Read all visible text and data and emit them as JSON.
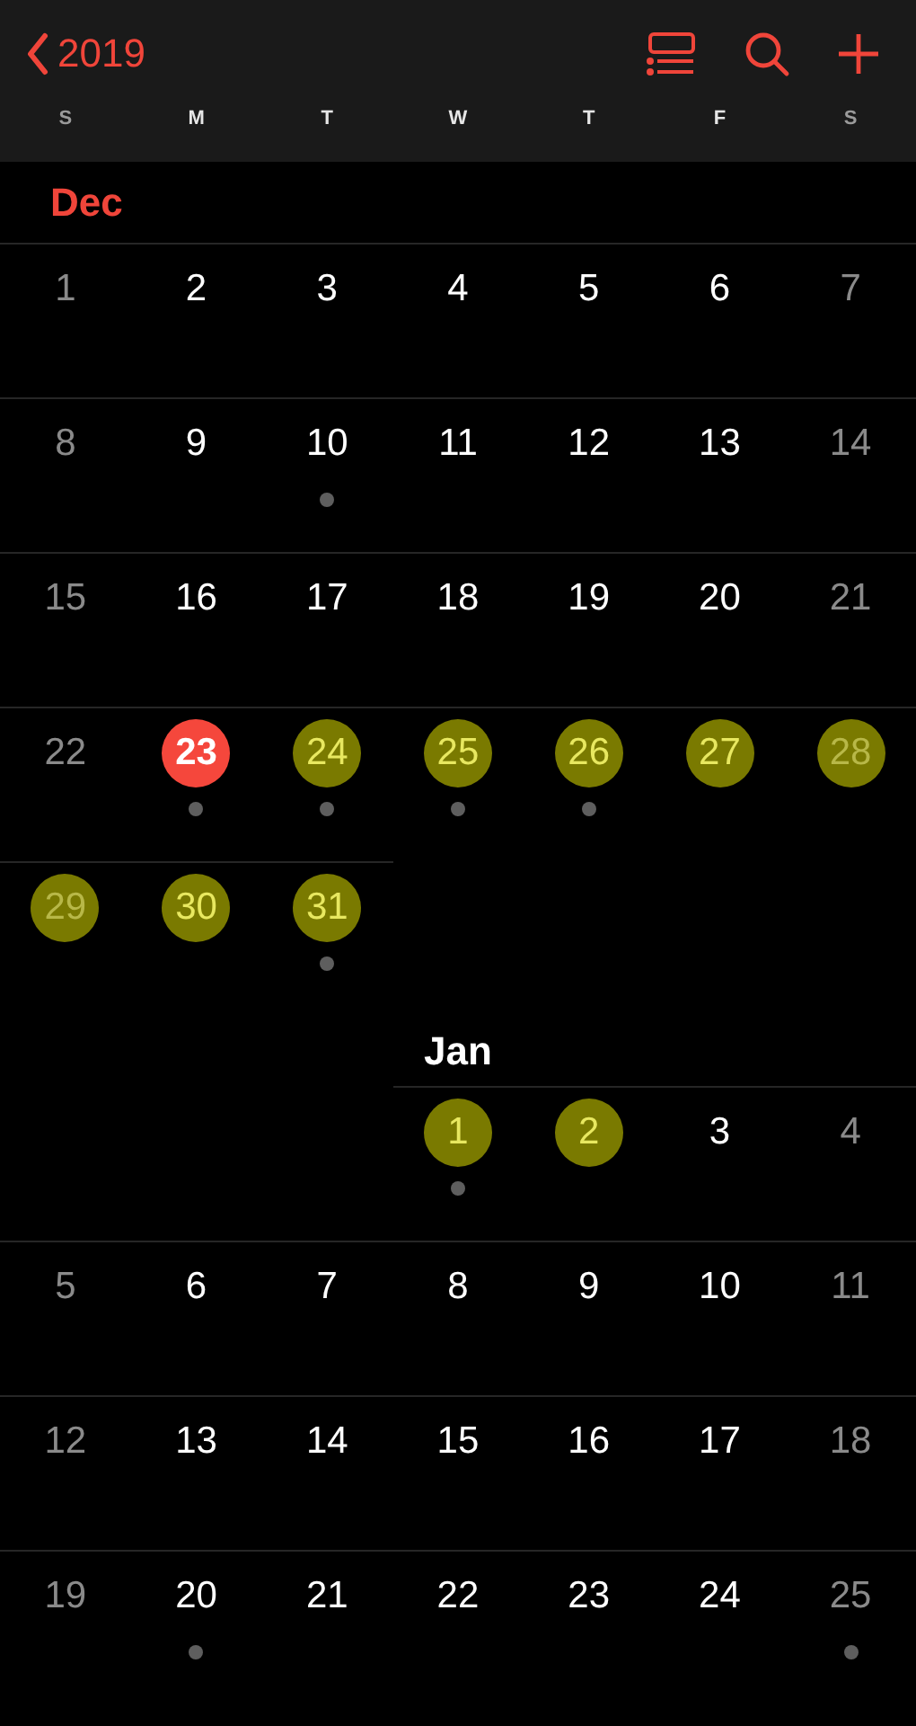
{
  "nav": {
    "back_label": "2019"
  },
  "weekdays": [
    {
      "label": "S",
      "weekend": true
    },
    {
      "label": "M",
      "weekend": false
    },
    {
      "label": "T",
      "weekend": false
    },
    {
      "label": "W",
      "weekend": false
    },
    {
      "label": "T",
      "weekend": false
    },
    {
      "label": "F",
      "weekend": false
    },
    {
      "label": "S",
      "weekend": true
    }
  ],
  "months": [
    {
      "name": "Dec",
      "current": true,
      "weeks": [
        [
          {
            "label": "1",
            "weekend": true,
            "today": false,
            "highlighted": false,
            "event": false
          },
          {
            "label": "2",
            "weekend": false,
            "today": false,
            "highlighted": false,
            "event": false
          },
          {
            "label": "3",
            "weekend": false,
            "today": false,
            "highlighted": false,
            "event": false
          },
          {
            "label": "4",
            "weekend": false,
            "today": false,
            "highlighted": false,
            "event": false
          },
          {
            "label": "5",
            "weekend": false,
            "today": false,
            "highlighted": false,
            "event": false
          },
          {
            "label": "6",
            "weekend": false,
            "today": false,
            "highlighted": false,
            "event": false
          },
          {
            "label": "7",
            "weekend": true,
            "today": false,
            "highlighted": false,
            "event": false
          }
        ],
        [
          {
            "label": "8",
            "weekend": true,
            "today": false,
            "highlighted": false,
            "event": false
          },
          {
            "label": "9",
            "weekend": false,
            "today": false,
            "highlighted": false,
            "event": false
          },
          {
            "label": "10",
            "weekend": false,
            "today": false,
            "highlighted": false,
            "event": true
          },
          {
            "label": "11",
            "weekend": false,
            "today": false,
            "highlighted": false,
            "event": false
          },
          {
            "label": "12",
            "weekend": false,
            "today": false,
            "highlighted": false,
            "event": false
          },
          {
            "label": "13",
            "weekend": false,
            "today": false,
            "highlighted": false,
            "event": false
          },
          {
            "label": "14",
            "weekend": true,
            "today": false,
            "highlighted": false,
            "event": false
          }
        ],
        [
          {
            "label": "15",
            "weekend": true,
            "today": false,
            "highlighted": false,
            "event": false
          },
          {
            "label": "16",
            "weekend": false,
            "today": false,
            "highlighted": false,
            "event": false
          },
          {
            "label": "17",
            "weekend": false,
            "today": false,
            "highlighted": false,
            "event": false
          },
          {
            "label": "18",
            "weekend": false,
            "today": false,
            "highlighted": false,
            "event": false
          },
          {
            "label": "19",
            "weekend": false,
            "today": false,
            "highlighted": false,
            "event": false
          },
          {
            "label": "20",
            "weekend": false,
            "today": false,
            "highlighted": false,
            "event": false
          },
          {
            "label": "21",
            "weekend": true,
            "today": false,
            "highlighted": false,
            "event": false
          }
        ],
        [
          {
            "label": "22",
            "weekend": true,
            "today": false,
            "highlighted": false,
            "event": false
          },
          {
            "label": "23",
            "weekend": false,
            "today": true,
            "highlighted": false,
            "event": true
          },
          {
            "label": "24",
            "weekend": false,
            "today": false,
            "highlighted": true,
            "event": true
          },
          {
            "label": "25",
            "weekend": false,
            "today": false,
            "highlighted": true,
            "event": true
          },
          {
            "label": "26",
            "weekend": false,
            "today": false,
            "highlighted": true,
            "event": true
          },
          {
            "label": "27",
            "weekend": false,
            "today": false,
            "highlighted": true,
            "event": false
          },
          {
            "label": "28",
            "weekend": true,
            "today": false,
            "highlighted": true,
            "event": false
          }
        ],
        [
          {
            "label": "29",
            "weekend": true,
            "today": false,
            "highlighted": true,
            "event": false
          },
          {
            "label": "30",
            "weekend": false,
            "today": false,
            "highlighted": true,
            "event": false
          },
          {
            "label": "31",
            "weekend": false,
            "today": false,
            "highlighted": true,
            "event": true
          },
          {
            "kind": "blank"
          },
          {
            "kind": "blank"
          },
          {
            "kind": "blank"
          },
          {
            "kind": "blank"
          }
        ]
      ]
    },
    {
      "name": "Jan",
      "current": false,
      "weeks": [
        [
          {
            "kind": "blank"
          },
          {
            "kind": "blank"
          },
          {
            "kind": "blank"
          },
          {
            "label": "1",
            "weekend": false,
            "today": false,
            "highlighted": true,
            "event": true
          },
          {
            "label": "2",
            "weekend": false,
            "today": false,
            "highlighted": true,
            "event": false
          },
          {
            "label": "3",
            "weekend": false,
            "today": false,
            "highlighted": false,
            "event": false
          },
          {
            "label": "4",
            "weekend": true,
            "today": false,
            "highlighted": false,
            "event": false
          }
        ],
        [
          {
            "label": "5",
            "weekend": true,
            "today": false,
            "highlighted": false,
            "event": false
          },
          {
            "label": "6",
            "weekend": false,
            "today": false,
            "highlighted": false,
            "event": false
          },
          {
            "label": "7",
            "weekend": false,
            "today": false,
            "highlighted": false,
            "event": false
          },
          {
            "label": "8",
            "weekend": false,
            "today": false,
            "highlighted": false,
            "event": false
          },
          {
            "label": "9",
            "weekend": false,
            "today": false,
            "highlighted": false,
            "event": false
          },
          {
            "label": "10",
            "weekend": false,
            "today": false,
            "highlighted": false,
            "event": false
          },
          {
            "label": "11",
            "weekend": true,
            "today": false,
            "highlighted": false,
            "event": false
          }
        ],
        [
          {
            "label": "12",
            "weekend": true,
            "today": false,
            "highlighted": false,
            "event": false
          },
          {
            "label": "13",
            "weekend": false,
            "today": false,
            "highlighted": false,
            "event": false
          },
          {
            "label": "14",
            "weekend": false,
            "today": false,
            "highlighted": false,
            "event": false
          },
          {
            "label": "15",
            "weekend": false,
            "today": false,
            "highlighted": false,
            "event": false
          },
          {
            "label": "16",
            "weekend": false,
            "today": false,
            "highlighted": false,
            "event": false
          },
          {
            "label": "17",
            "weekend": false,
            "today": false,
            "highlighted": false,
            "event": false
          },
          {
            "label": "18",
            "weekend": true,
            "today": false,
            "highlighted": false,
            "event": false
          }
        ],
        [
          {
            "label": "19",
            "weekend": true,
            "today": false,
            "highlighted": false,
            "event": false
          },
          {
            "label": "20",
            "weekend": false,
            "today": false,
            "highlighted": false,
            "event": true
          },
          {
            "label": "21",
            "weekend": false,
            "today": false,
            "highlighted": false,
            "event": false
          },
          {
            "label": "22",
            "weekend": false,
            "today": false,
            "highlighted": false,
            "event": false
          },
          {
            "label": "23",
            "weekend": false,
            "today": false,
            "highlighted": false,
            "event": false
          },
          {
            "label": "24",
            "weekend": false,
            "today": false,
            "highlighted": false,
            "event": false
          },
          {
            "label": "25",
            "weekend": true,
            "today": false,
            "highlighted": false,
            "event": true
          }
        ]
      ]
    }
  ]
}
